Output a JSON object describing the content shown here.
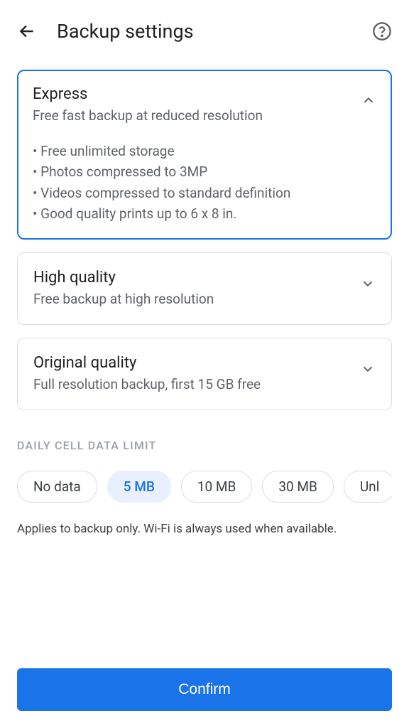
{
  "header": {
    "title": "Backup settings"
  },
  "options": [
    {
      "title": "Express",
      "subtitle": "Free fast backup at reduced resolution",
      "selected": true,
      "bullets": [
        "Free unlimited storage",
        "Photos compressed to 3MP",
        "Videos compressed to standard definition",
        "Good quality prints up to 6 x 8 in."
      ]
    },
    {
      "title": "High quality",
      "subtitle": "Free backup at high resolution",
      "selected": false
    },
    {
      "title": "Original quality",
      "subtitle": "Full resolution backup, first 15 GB free",
      "selected": false
    }
  ],
  "dataLimit": {
    "sectionLabel": "DAILY CELL DATA LIMIT",
    "chips": [
      "No data",
      "5 MB",
      "10 MB",
      "30 MB",
      "Unl"
    ],
    "selectedIndex": 1,
    "caption": "Applies to backup only. Wi-Fi is always used when available."
  },
  "confirmLabel": "Confirm"
}
